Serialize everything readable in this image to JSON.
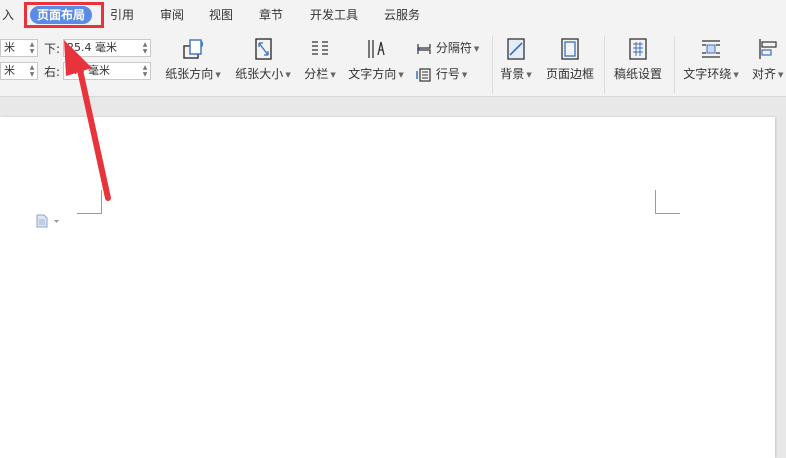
{
  "tabs": [
    {
      "label": "入",
      "active": false
    },
    {
      "label": "页面布局",
      "active": true
    },
    {
      "label": "引用",
      "active": false
    },
    {
      "label": "审阅",
      "active": false
    },
    {
      "label": "视图",
      "active": false
    },
    {
      "label": "章节",
      "active": false
    },
    {
      "label": "开发工具",
      "active": false
    },
    {
      "label": "云服务",
      "active": false
    }
  ],
  "margins": {
    "top_left_value": "米",
    "bottom_left_value": "米",
    "bottom_label": "下:",
    "bottom_value": "25.4 毫米",
    "right_label": "右:",
    "right_value": "1.8 毫米"
  },
  "ribbon": {
    "orientation": "纸张方向",
    "size": "纸张大小",
    "columns": "分栏",
    "text_direction": "文字方向",
    "breaks": "分隔符",
    "line_numbers": "行号",
    "background": "背景",
    "page_border": "页面边框",
    "manuscript": "稿纸设置",
    "text_wrap": "文字环绕",
    "align": "对齐"
  },
  "colors": {
    "active_tab": "#5a8be6",
    "highlight": "#e8323c",
    "icon_blue": "#3a6fc4"
  }
}
